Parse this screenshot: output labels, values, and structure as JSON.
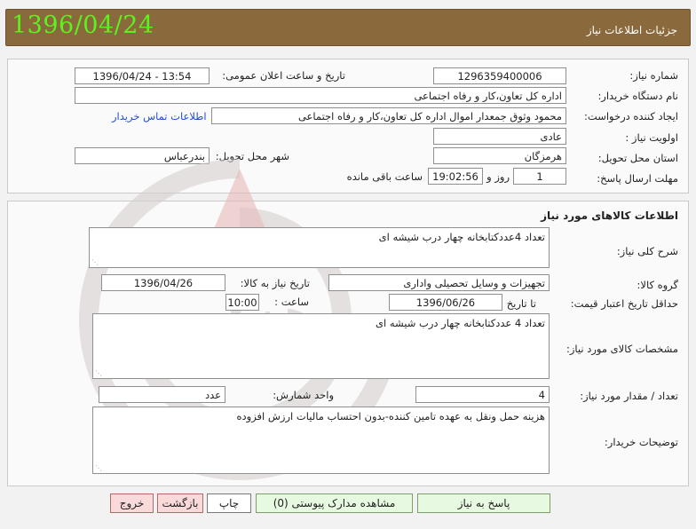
{
  "header": {
    "date": "1396/04/24",
    "title": "جزئیات اطلاعات نیاز"
  },
  "need_info": {
    "need_number_label": "شماره نیاز:",
    "need_number": "1296359400006",
    "announce_label": "تاریخ و ساعت اعلان عمومی:",
    "announce_value": "1396/04/24 - 13:54",
    "buyer_org_label": "نام دستگاه خریدار:",
    "buyer_org": "اداره کل تعاون،کار و رفاه اجتماعی",
    "requester_label": "ایجاد کننده درخواست:",
    "requester": "محمود  وثوق جمعدار اموال اداره کل تعاون،کار و رفاه اجتماعی",
    "contact_link": "اطلاعات تماس خریدار",
    "priority_label": "اولویت نیاز :",
    "priority": "عادی",
    "province_label": "استان محل تحویل:",
    "province": "هرمزگان",
    "city_label": "شهر محل تحویل:",
    "city": "بندرعباس",
    "deadline_label": "مهلت ارسال پاسخ:",
    "days_value": "1",
    "days_suffix": "روز و",
    "time_value": "19:02:56",
    "time_suffix": "ساعت باقی مانده"
  },
  "goods": {
    "section_title": "اطلاعات کالاهای مورد نیاز",
    "summary_label": "شرح کلی نیاز:",
    "summary": "تعداد 4عددکتابخانه چهار درب شیشه ای",
    "group_label": "گروه کالا:",
    "group": "تجهیزات و وسایل تحصیلی واداری",
    "need_date_label": "تاریخ نیاز به کالا:",
    "need_date": "1396/04/26",
    "validity_label": "حداقل تاریخ اعتبار قیمت:",
    "to_date_label": "تا تاریخ :",
    "to_date": "1396/06/26",
    "hour_label": "ساعت :",
    "hour": "10:00",
    "specs_label": "مشخصات کالای مورد نیاز:",
    "specs": "تعداد 4 عددکتابخانه چهار درب شیشه ای",
    "quantity_label": "تعداد / مقدار مورد نیاز:",
    "quantity": "4",
    "unit_label": "واحد شمارش:",
    "unit": "عدد",
    "buyer_notes_label": "توضیحات خریدار:",
    "buyer_notes": "هزینه حمل ونقل به عهده تامین کننده-بدون احتساب مالیات ارزش افزوده"
  },
  "buttons": {
    "reply": "پاسخ به نیاز",
    "attachments": "مشاهده مدارک پیوستی (0)",
    "print": "چاپ",
    "back": "بازگشت",
    "exit": "خروج"
  }
}
